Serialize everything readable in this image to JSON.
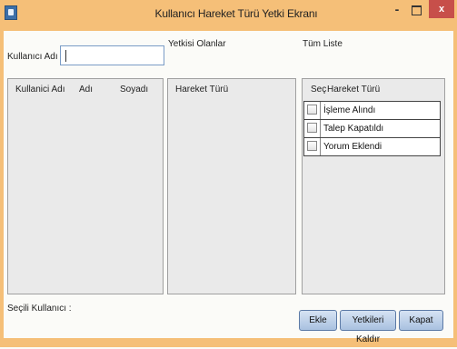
{
  "window": {
    "title": "Kullanıcı Hareket Türü Yetki Ekranı",
    "close_glyph": "x",
    "minimize_glyph": "-"
  },
  "user_search": {
    "label": "Kullanıcı Adı",
    "value": ""
  },
  "users_grid": {
    "columns": [
      "Kullanici Adı",
      "Adı",
      "Soyadı"
    ]
  },
  "authorized": {
    "title": "Yetkisi Olanlar",
    "columns": [
      "Hareket Türü"
    ]
  },
  "full_list": {
    "title": "Tüm Liste",
    "columns": [
      "Seç",
      "Hareket Türü"
    ],
    "rows": [
      {
        "selected": false,
        "label": "İşleme Alındı"
      },
      {
        "selected": false,
        "label": "Talep Kapatıldı"
      },
      {
        "selected": false,
        "label": "Yorum Eklendi"
      }
    ]
  },
  "selected_user": {
    "label": "Seçili Kullanıcı :"
  },
  "buttons": {
    "add": "Ekle",
    "remove": "Yetkileri Kaldır",
    "close": "Kapat"
  }
}
